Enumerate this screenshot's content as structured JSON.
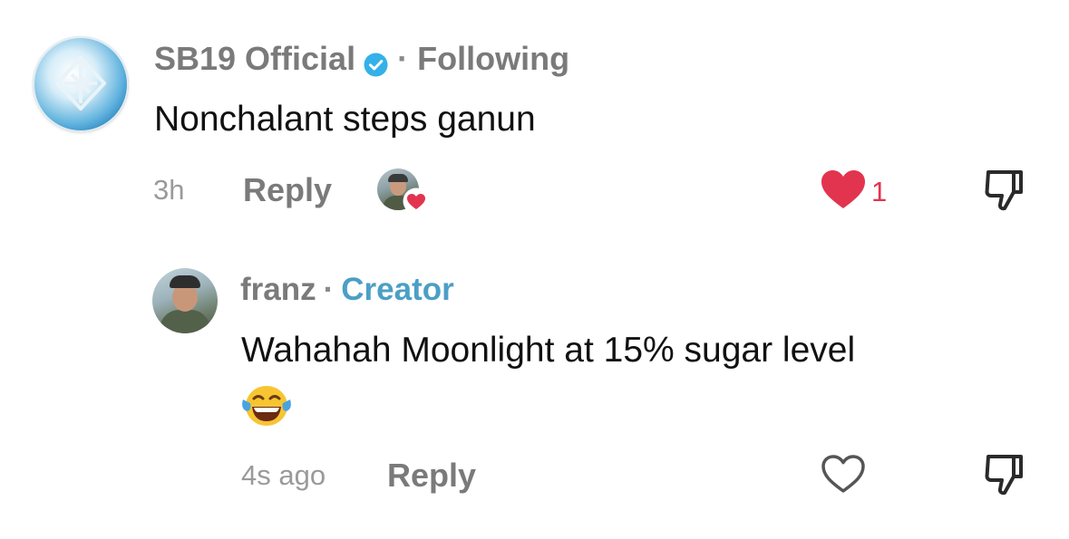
{
  "comment": {
    "username": "SB19 Official",
    "separator": "·",
    "follow_status": "Following",
    "text": "Nonchalant steps ganun",
    "time": "3h",
    "reply_label": "Reply",
    "like_count": "1",
    "liked": true,
    "icons": {
      "verified": "verified-badge-icon",
      "like": "heart-filled-icon",
      "dislike": "thumbs-down-icon",
      "liked_by_creator": "creator-heart-badge-icon"
    }
  },
  "reply": {
    "username": "franz",
    "separator": "·",
    "role_badge": "Creator",
    "text": "Wahahah Moonlight at 15% sugar level",
    "emoji": "face-with-tears-of-joy",
    "time": "4s ago",
    "reply_label": "Reply",
    "liked": false,
    "icons": {
      "like": "heart-outline-icon",
      "dislike": "thumbs-down-icon"
    }
  },
  "colors": {
    "like_red": "#e2344f",
    "creator_blue": "#4b9fc6",
    "verified_blue": "#33b1e8",
    "secondary_text": "#7a7a7a"
  }
}
